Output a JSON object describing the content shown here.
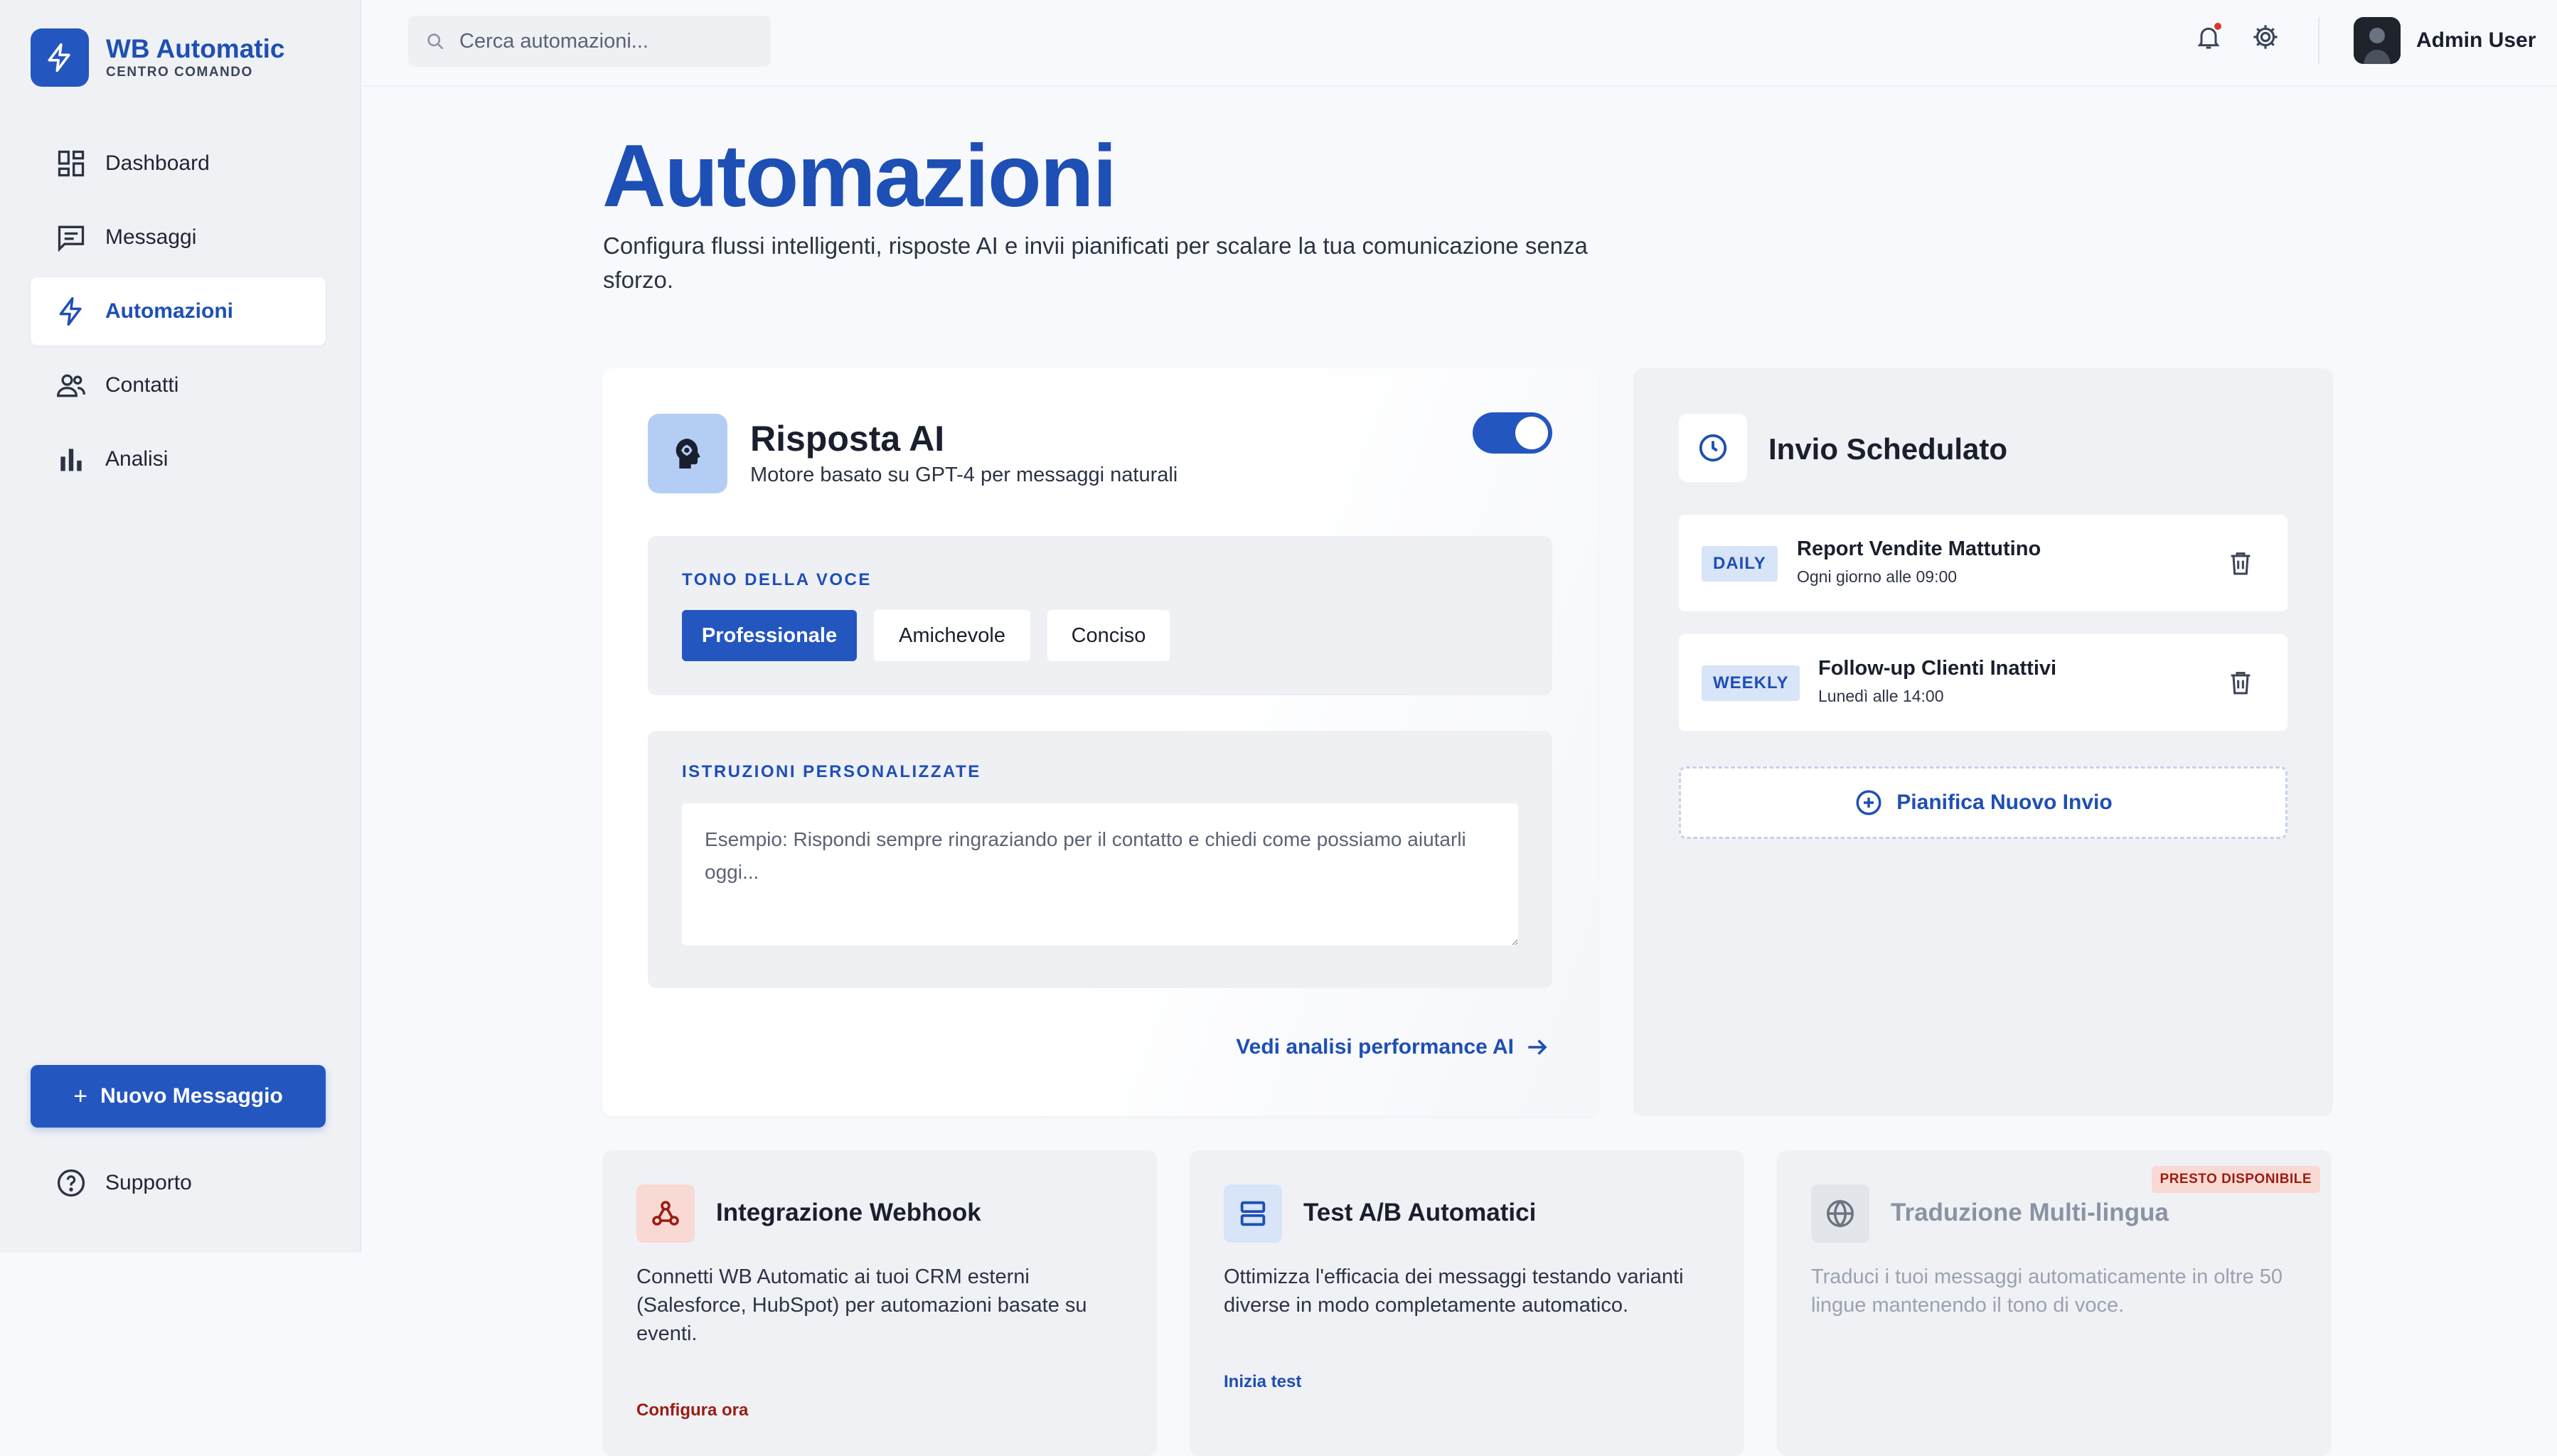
{
  "brand": {
    "title": "WB Automatic",
    "subtitle": "CENTRO COMANDO",
    "logo_icon": "lightning-icon"
  },
  "colors": {
    "accent": "#2456c0",
    "accent_text": "#1e4fb5",
    "badge_bg": "#f9d9d4",
    "danger": "#d33a2c"
  },
  "nav": {
    "items": [
      {
        "label": "Dashboard",
        "icon": "dashboard-icon",
        "active": false
      },
      {
        "label": "Messaggi",
        "icon": "chat-icon",
        "active": false
      },
      {
        "label": "Automazioni",
        "icon": "lightning-icon",
        "active": true
      },
      {
        "label": "Contatti",
        "icon": "people-icon",
        "active": false
      },
      {
        "label": "Analisi",
        "icon": "bar-chart-icon",
        "active": false
      }
    ]
  },
  "sidebar_footer": {
    "new_message": "Nuovo Messaggio",
    "new_message_prefix": "+",
    "support": "Supporto"
  },
  "topbar": {
    "search_placeholder": "Cerca automazioni...",
    "user_name": "Admin User",
    "notifications_unread": true
  },
  "header": {
    "title": "Automazioni",
    "description": "Configura flussi intelligenti, risposte AI e invii pianificati per scalare la tua comunicazione senza sforzo."
  },
  "ai_card": {
    "title": "Risposta AI",
    "subtitle": "Motore basato su GPT-4 per messaggi naturali",
    "enabled": true,
    "tone_label": "TONO DELLA VOCE",
    "tones": [
      {
        "label": "Professionale",
        "active": true
      },
      {
        "label": "Amichevole",
        "active": false
      },
      {
        "label": "Conciso",
        "active": false
      }
    ],
    "instructions_label": "ISTRUZIONI PERSONALIZZATE",
    "instructions_placeholder": "Esempio: Rispondi sempre ringraziando per il contatto e chiedi come possiamo aiutarli oggi...",
    "instructions_value": "",
    "performance_link": "Vedi analisi performance AI"
  },
  "schedule": {
    "title": "Invio Schedulato",
    "items": [
      {
        "frequency": "DAILY",
        "name": "Report Vendite Mattutino",
        "time": "Ogni giorno alle 09:00"
      },
      {
        "frequency": "WEEKLY",
        "name": "Follow-up Clienti Inattivi",
        "time": "Lunedì alle 14:00"
      }
    ],
    "add_label": "Pianifica Nuovo Invio"
  },
  "features": [
    {
      "title": "Integrazione Webhook",
      "icon": "webhook-icon",
      "description": "Connetti WB Automatic ai tuoi CRM esterni (Salesforce, HubSpot) per automazioni basate su eventi.",
      "link": "Configura ora",
      "link_color": "#9b1c12"
    },
    {
      "title": "Test A/B Automatici",
      "icon": "split-test-icon",
      "description": "Ottimizza l'efficacia dei messaggi testando varianti diverse in modo completamente automatico.",
      "link": "Inizia test",
      "link_color": "#1e4fb5"
    },
    {
      "title": "Traduzione Multi-lingua",
      "icon": "globe-icon",
      "description": "Traduci i tuoi messaggi automaticamente in oltre 50 lingue mantenendo il tono di voce.",
      "badge": "PRESTO DISPONIBILE",
      "disabled": true
    }
  ]
}
